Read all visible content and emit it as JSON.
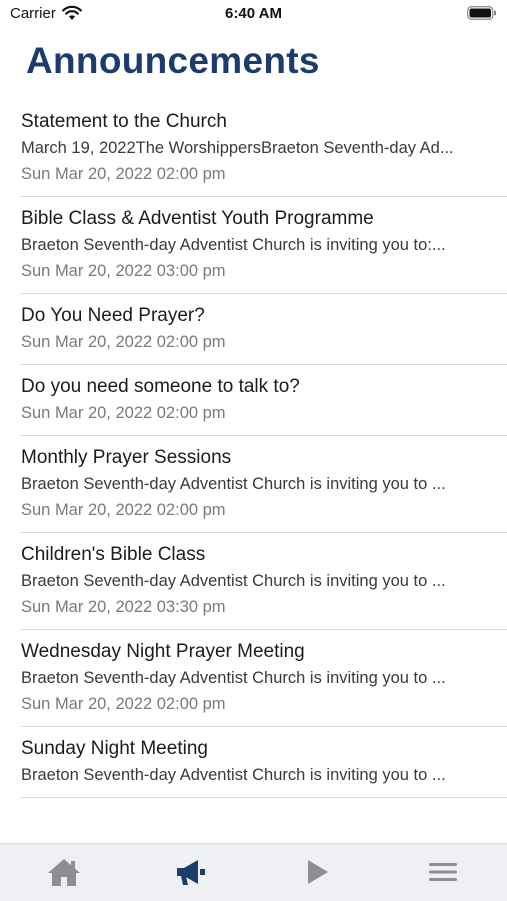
{
  "status_bar": {
    "carrier": "Carrier",
    "time": "6:40 AM"
  },
  "header": {
    "title": "Announcements"
  },
  "announcements": [
    {
      "title": "Statement to the Church",
      "description": "March 19, 2022The WorshippersBraeton Seventh-day Ad...",
      "date": "Sun Mar 20, 2022 02:00 pm"
    },
    {
      "title": "Bible Class & Adventist Youth Programme",
      "description": "Braeton Seventh-day Adventist Church is inviting you to:...",
      "date": "Sun Mar 20, 2022 03:00 pm"
    },
    {
      "title": "Do You Need Prayer?",
      "description": "",
      "date": "Sun Mar 20, 2022 02:00 pm"
    },
    {
      "title": "Do you need someone to talk to?",
      "description": "",
      "date": "Sun Mar 20, 2022 02:00 pm"
    },
    {
      "title": "Monthly Prayer Sessions",
      "description": "Braeton Seventh-day Adventist Church is inviting you to ...",
      "date": "Sun Mar 20, 2022 02:00 pm"
    },
    {
      "title": "Children's Bible Class",
      "description": "Braeton Seventh-day Adventist Church is inviting you to ...",
      "date": "Sun Mar 20, 2022 03:30 pm"
    },
    {
      "title": "Wednesday Night Prayer Meeting",
      "description": "Braeton Seventh-day Adventist Church is inviting you to ...",
      "date": "Sun Mar 20, 2022 02:00 pm"
    },
    {
      "title": "Sunday Night Meeting",
      "description": "Braeton Seventh-day Adventist Church is inviting you to ...",
      "date": ""
    }
  ],
  "tab_bar": {
    "tabs": [
      {
        "icon": "home-icon",
        "active": false
      },
      {
        "icon": "megaphone-icon",
        "active": true
      },
      {
        "icon": "play-icon",
        "active": false
      },
      {
        "icon": "menu-icon",
        "active": false
      }
    ],
    "active_color": "#1d3c6e",
    "inactive_color": "#8e8e93"
  }
}
